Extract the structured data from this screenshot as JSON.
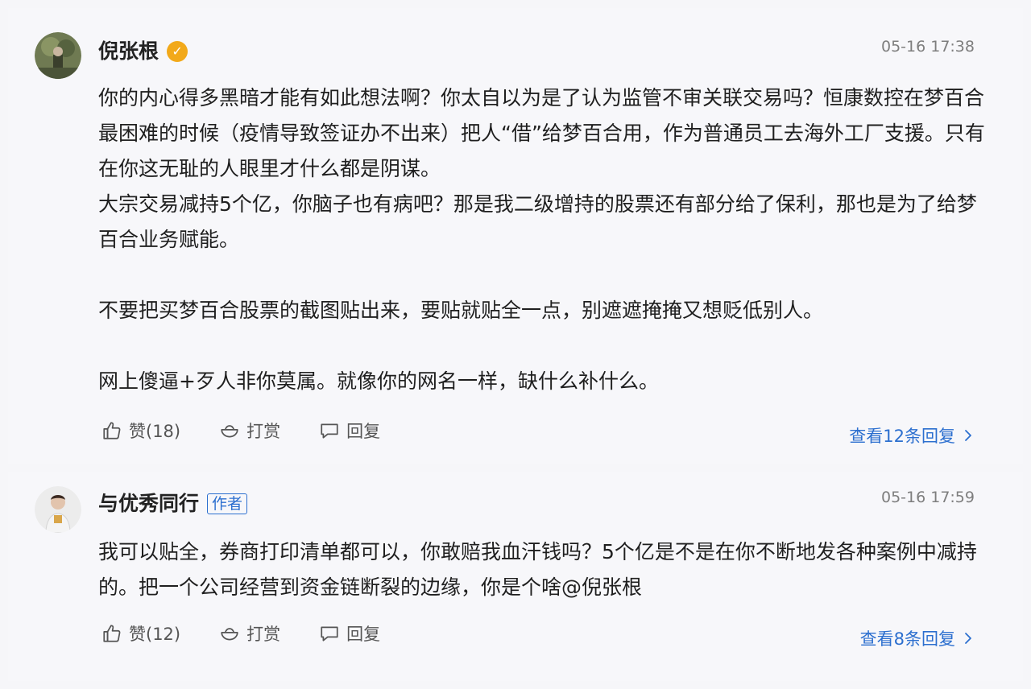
{
  "comments": [
    {
      "username": "倪张根",
      "verified_icon": "verified-badge-icon",
      "timestamp": "05-16 17:38",
      "paragraphs": [
        "你的内心得多黑暗才能有如此想法啊？你太自以为是了认为监管不审关联交易吗？恒康数控在梦百合最困难的时候（疫情导致签证办不出来）把人“借”给梦百合用，作为普通员工去海外工厂支援。只有在你这无耻的人眼里才什么都是阴谋。",
        "大宗交易减持5个亿，你脑子也有病吧？那是我二级增持的股票还有部分给了保利，那也是为了给梦百合业务赋能。",
        "",
        "不要把买梦百合股票的截图贴出来，要贴就贴全一点，别遮遮掩掩又想贬低别人。",
        "",
        "网上傻逼+歹人非你莫属。就像你的网名一样，缺什么补什么。"
      ],
      "actions": {
        "like_label": "赞(18)",
        "tip_label": "打赏",
        "reply_label": "回复"
      },
      "view_replies": "查看12条回复"
    },
    {
      "username": "与优秀同行",
      "author_tag": "作者",
      "timestamp": "05-16 17:59",
      "paragraphs": [
        "我可以贴全，券商打印清单都可以，你敢赔我血汗钱吗？5个亿是不是在你不断地发各种案例中减持的。把一个公司经营到资金链断裂的边缘，你是个啥@倪张根"
      ],
      "actions": {
        "like_label": "赞(12)",
        "tip_label": "打赏",
        "reply_label": "回复"
      },
      "view_replies": "查看8条回复"
    }
  ],
  "icons": {
    "like": "thumbs-up-icon",
    "tip": "tip-bowl-icon",
    "reply": "comment-bubble-icon",
    "chevron": "chevron-right-icon"
  },
  "colors": {
    "link": "#2c6fcf",
    "verified": "#f2a91a",
    "muted": "#7e7e7e"
  }
}
